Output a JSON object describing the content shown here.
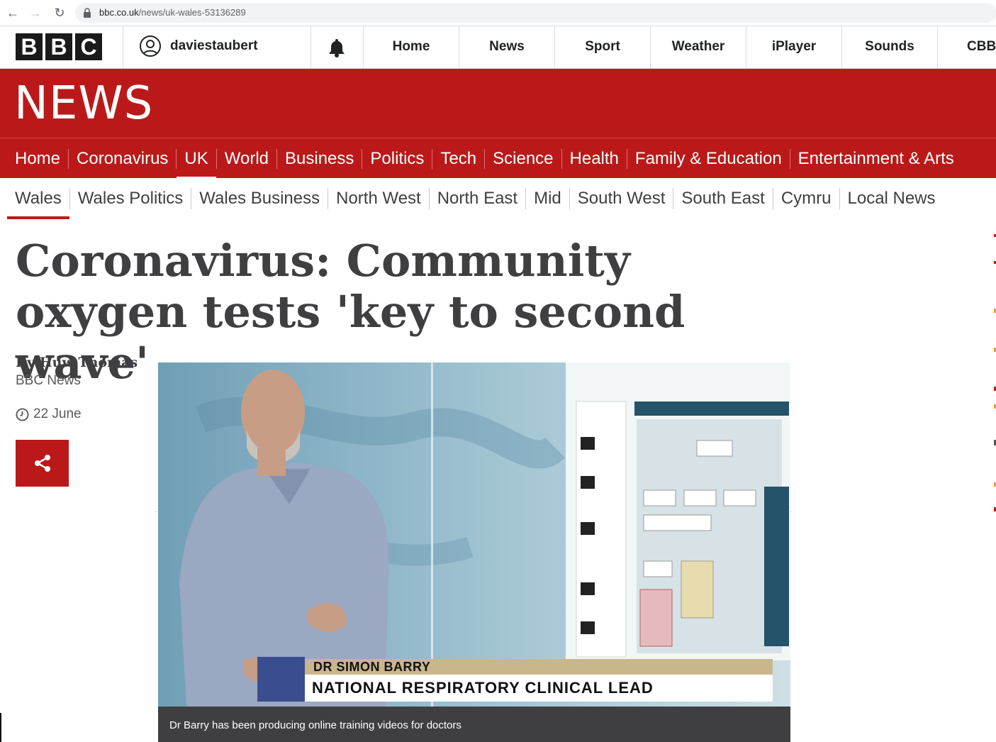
{
  "browser": {
    "back": "←",
    "forward": "→",
    "reload": "↻",
    "url_host": "bbc.co.uk",
    "url_path": "/news/uk-wales-53136289"
  },
  "bbc_bar": {
    "logo": [
      "B",
      "B",
      "C"
    ],
    "username": "daviestaubert",
    "nav": [
      "Home",
      "News",
      "Sport",
      "Weather",
      "iPlayer",
      "Sounds",
      "CBBC"
    ]
  },
  "news_banner": {
    "title": "NEWS"
  },
  "main_nav": [
    "Home",
    "Coronavirus",
    "UK",
    "World",
    "Business",
    "Politics",
    "Tech",
    "Science",
    "Health",
    "Family & Education",
    "Entertainment & Arts"
  ],
  "main_nav_active": "UK",
  "sub_nav": [
    "Wales",
    "Wales Politics",
    "Wales Business",
    "North West",
    "North East",
    "Mid",
    "South West",
    "South East",
    "Cymru",
    "Local News"
  ],
  "sub_nav_active": "Wales",
  "article": {
    "headline": "Coronavirus: Community oxygen tests 'key to second wave'",
    "byline_name": "By Huw Thomas",
    "byline_org": "BBC News",
    "date": "22 June"
  },
  "hero": {
    "lower_third_name": "DR SIMON BARRY",
    "lower_third_role": "NATIONAL RESPIRATORY CLINICAL LEAD",
    "caption": "Dr Barry has been producing online training videos for doctors"
  },
  "colors": {
    "bbc_red": "#bb1919",
    "text_dark": "#3f3f42"
  }
}
